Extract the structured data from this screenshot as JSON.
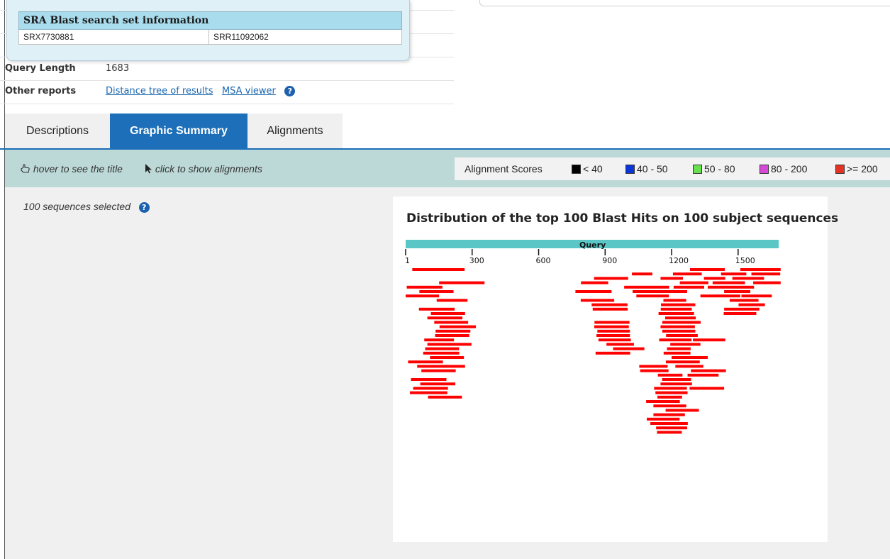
{
  "sra_popup": {
    "title": "SRA Blast search set information",
    "experiment": "SRX7730881",
    "run": "SRR11092062"
  },
  "info": {
    "query_length_label": "Query Length",
    "query_length_value": "1683",
    "other_reports_label": "Other reports",
    "link_distance_tree": "Distance tree of results",
    "link_msa_viewer": "MSA viewer",
    "help_glyph": "?"
  },
  "tabs": [
    {
      "label": "Descriptions",
      "active": false
    },
    {
      "label": "Graphic Summary",
      "active": true
    },
    {
      "label": "Alignments",
      "active": false
    }
  ],
  "toolbar": {
    "hover_hint": "hover to see the title",
    "click_hint": "click to show alignments",
    "hover_icon": "hand-pointer-icon",
    "click_icon": "arrow-cursor-icon"
  },
  "legend": {
    "title": "Alignment Scores",
    "items": [
      {
        "label": "< 40",
        "color": "#000000"
      },
      {
        "label": "40 - 50",
        "color": "#0a35d9"
      },
      {
        "label": "50 - 80",
        "color": "#66e04e"
      },
      {
        "label": "80 - 200",
        "color": "#d548d8"
      },
      {
        "label": ">= 200",
        "color": "#e23324"
      }
    ]
  },
  "selection": {
    "text": "100 sequences selected"
  },
  "chart_data": {
    "type": "alignment-map",
    "title": "Distribution of the top 100 Blast Hits on 100 subject sequences",
    "query_label": "Query",
    "query_length": 1683,
    "ticks": [
      1,
      300,
      600,
      900,
      1200,
      1500
    ],
    "hit_color": "#ff0000",
    "query_bar_color": "#5bc6c6",
    "hits": [
      [
        30,
        266
      ],
      [
        1283,
        1440
      ],
      [
        1021,
        1113
      ],
      [
        850,
        1004
      ],
      [
        1206,
        1336
      ],
      [
        1423,
        1537
      ],
      [
        151,
        356
      ],
      [
        5,
        166
      ],
      [
        1150,
        1251
      ],
      [
        791,
        914
      ],
      [
        1237,
        1366
      ],
      [
        1346,
        1442
      ],
      [
        986,
        1189
      ],
      [
        1510,
        1692
      ],
      [
        62,
        216
      ],
      [
        766,
        929
      ],
      [
        1024,
        1270
      ],
      [
        1385,
        1531
      ],
      [
        0,
        151
      ],
      [
        1041,
        1188
      ],
      [
        1209,
        1347
      ],
      [
        1474,
        1617
      ],
      [
        140,
        279
      ],
      [
        1363,
        1572
      ],
      [
        790,
        941
      ],
      [
        839,
        1001
      ],
      [
        60,
        221
      ],
      [
        1163,
        1266
      ],
      [
        1437,
        1555
      ],
      [
        1152,
        1307
      ],
      [
        1330,
        1510
      ],
      [
        1560,
        1690
      ],
      [
        114,
        268
      ],
      [
        844,
        1002
      ],
      [
        1151,
        1291
      ],
      [
        1462,
        1592
      ],
      [
        1141,
        1301
      ],
      [
        98,
        256
      ],
      [
        1171,
        1309
      ],
      [
        1568,
        1692
      ],
      [
        1502,
        1621
      ],
      [
        129,
        282
      ],
      [
        852,
        1010
      ],
      [
        1158,
        1331
      ],
      [
        1437,
        1596
      ],
      [
        153,
        317
      ],
      [
        851,
        1007
      ],
      [
        1150,
        1305
      ],
      [
        1515,
        1652
      ],
      [
        135,
        292
      ],
      [
        865,
        1012
      ],
      [
        1158,
        1307
      ],
      [
        1435,
        1582
      ],
      [
        133,
        287
      ],
      [
        861,
        1012
      ],
      [
        1175,
        1318
      ],
      [
        84,
        218
      ],
      [
        870,
        1016
      ],
      [
        1144,
        1290
      ],
      [
        98,
        297
      ],
      [
        906,
        1030
      ],
      [
        1194,
        1330
      ],
      [
        88,
        241
      ],
      [
        936,
        1077
      ],
      [
        1179,
        1286
      ],
      [
        79,
        242
      ],
      [
        857,
        1013
      ],
      [
        1164,
        1285
      ],
      [
        110,
        263
      ],
      [
        1200,
        1363
      ],
      [
        11,
        168
      ],
      [
        1174,
        1327
      ],
      [
        52,
        268
      ],
      [
        1054,
        1182
      ],
      [
        1217,
        1343
      ],
      [
        71,
        226
      ],
      [
        1058,
        1186
      ],
      [
        1138,
        1249
      ],
      [
        24,
        184
      ],
      [
        1157,
        1288
      ],
      [
        66,
        224
      ],
      [
        1150,
        1292
      ],
      [
        34,
        191
      ],
      [
        1121,
        1269
      ],
      [
        19,
        188
      ],
      [
        1127,
        1272
      ],
      [
        101,
        254
      ],
      [
        1136,
        1247
      ],
      [
        1085,
        1237
      ],
      [
        1287,
        1445
      ],
      [
        1118,
        1266
      ],
      [
        1272,
        1412
      ],
      [
        1173,
        1323
      ],
      [
        1118,
        1260
      ],
      [
        1088,
        1236
      ],
      [
        1281,
        1437
      ],
      [
        1104,
        1273
      ],
      [
        1130,
        1270
      ],
      [
        1296,
        1442
      ],
      [
        1134,
        1246
      ]
    ]
  }
}
